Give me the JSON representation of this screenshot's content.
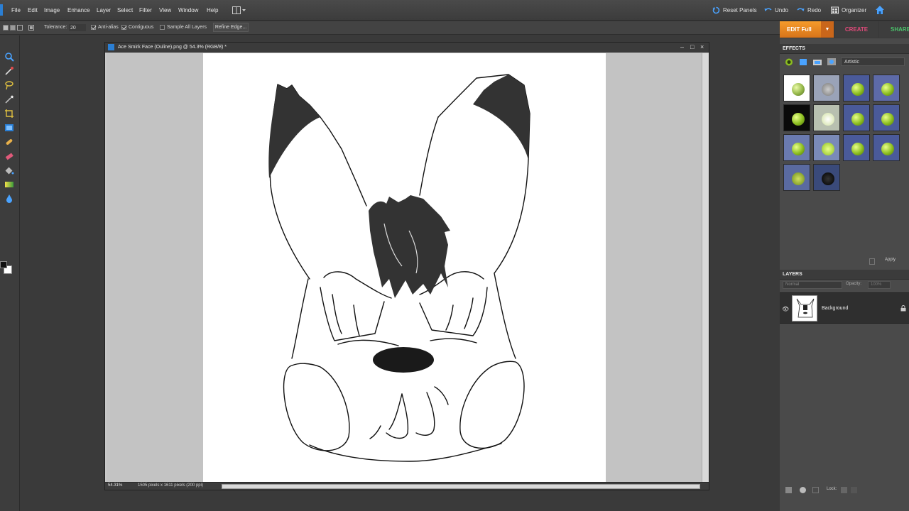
{
  "menubar": {
    "items": [
      "File",
      "Edit",
      "Image",
      "Enhance",
      "Layer",
      "Select",
      "Filter",
      "View",
      "Window",
      "Help"
    ],
    "reset_panels": "Reset Panels",
    "undo": "Undo",
    "redo": "Redo",
    "organizer": "Organizer"
  },
  "options": {
    "tolerance_label": "Tolerance:",
    "tolerance_value": "20",
    "anti_alias": "Anti-alias",
    "contiguous": "Contiguous",
    "sample_all_layers": "Sample All Layers",
    "refine_edge": "Refine Edge..."
  },
  "modes": {
    "edit": "EDIT Full",
    "create": "CREATE",
    "share": "SHARE"
  },
  "document": {
    "title": "Ace Smirk Face (Ouline).png @ 54.3% (RGB/8) *",
    "zoom": "54.31%",
    "dimensions": "1505 pixels x 1611 pixels (200 ppi)"
  },
  "effects": {
    "header": "EFFECTS",
    "category": "Artistic",
    "apply": "Apply"
  },
  "layers": {
    "header": "LAYERS",
    "blend_mode": "Normal",
    "opacity_label": "Opacity:",
    "opacity_value": "100%",
    "layer_name": "Background",
    "lock_label": "Lock:"
  },
  "colors": {
    "edit_tab": "#e8821f",
    "create_tab": "#e04a7a",
    "share_tab": "#4ac06a",
    "accent_blue": "#2b7fd4"
  }
}
